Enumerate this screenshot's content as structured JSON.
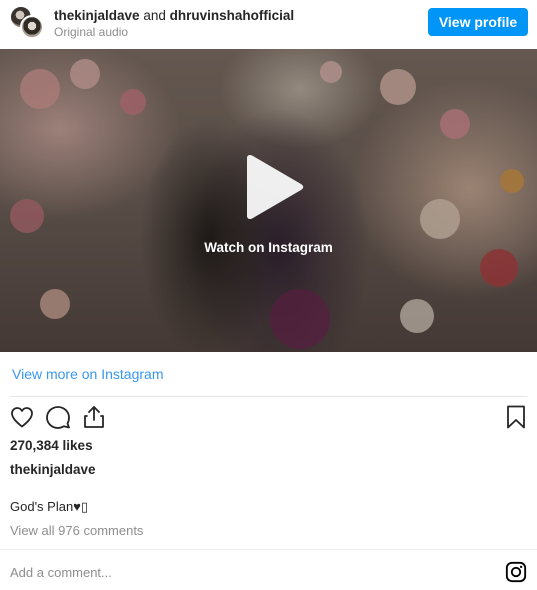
{
  "header": {
    "user1": "thekinjaldave",
    "connector": "and",
    "user2": "dhruvinshahofficial",
    "audio": "Original audio",
    "view_profile_label": "View profile"
  },
  "media": {
    "watch_label": "Watch on Instagram",
    "play_icon": "play-icon"
  },
  "links": {
    "view_more": "View more on Instagram"
  },
  "actions": {
    "icons": [
      "heart-icon",
      "comment-icon",
      "share-icon",
      "bookmark-icon"
    ]
  },
  "post": {
    "likes": "270,384 likes",
    "caption_user": "thekinjaldave",
    "caption": "God's Plan♥▯",
    "view_comments": "View all 976 comments"
  },
  "comment_box": {
    "placeholder": "Add a comment...",
    "logo_icon": "instagram-icon"
  },
  "colors": {
    "accent": "#0095f6",
    "link": "#3897f0",
    "muted": "#8e8e8e"
  }
}
